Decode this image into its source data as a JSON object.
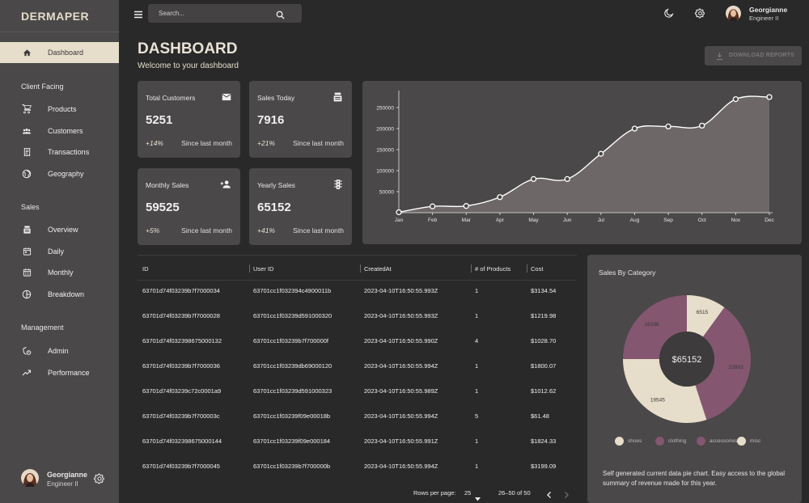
{
  "brand": "DERMAPER",
  "sidebar": {
    "items": [
      {
        "label": "Dashboard",
        "icon": "home-icon",
        "active": true
      },
      {
        "section": "Client Facing"
      },
      {
        "label": "Products",
        "icon": "cart-icon"
      },
      {
        "label": "Customers",
        "icon": "groups-icon"
      },
      {
        "label": "Transactions",
        "icon": "receipt-icon"
      },
      {
        "label": "Geography",
        "icon": "globe-icon"
      },
      {
        "section": "Sales"
      },
      {
        "label": "Overview",
        "icon": "point-of-sale-icon"
      },
      {
        "label": "Daily",
        "icon": "calendar-today-icon"
      },
      {
        "label": "Monthly",
        "icon": "calendar-month-icon"
      },
      {
        "label": "Breakdown",
        "icon": "pie-chart-icon"
      },
      {
        "section": "Management"
      },
      {
        "label": "Admin",
        "icon": "admin-shield-icon"
      },
      {
        "label": "Performance",
        "icon": "trending-up-icon"
      }
    ],
    "user": {
      "name": "Georgianne",
      "role": "Engineer II"
    }
  },
  "topbar": {
    "search_placeholder": "Search...",
    "user": {
      "name": "Georgianne",
      "role": "Engineer II"
    }
  },
  "header": {
    "title": "DASHBOARD",
    "subtitle": "Welcome to your dashboard",
    "download_label": "DOWNLOAD REPORTS"
  },
  "stats": [
    {
      "title": "Total Customers",
      "value": "5251",
      "pct": "+14%",
      "since": "Since last month",
      "icon": "email-icon"
    },
    {
      "title": "Sales Today",
      "value": "7916",
      "pct": "+21%",
      "since": "Since last month",
      "icon": "point-of-sale-icon"
    },
    {
      "title": "Monthly Sales",
      "value": "59525",
      "pct": "+5%",
      "since": "Since last month",
      "icon": "person-add-icon"
    },
    {
      "title": "Yearly Sales",
      "value": "65152",
      "pct": "+41%",
      "since": "Since last month",
      "icon": "traffic-icon"
    }
  ],
  "chart_data": [
    {
      "type": "area",
      "title": "",
      "categories": [
        "Jan",
        "Feb",
        "Mar",
        "Apr",
        "May",
        "Jun",
        "Jul",
        "Aug",
        "Sep",
        "Oct",
        "Nov",
        "Dec"
      ],
      "series": [
        {
          "values": [
            1000,
            15000,
            16000,
            37000,
            80000,
            80000,
            140000,
            200000,
            205000,
            207000,
            270000,
            275000
          ]
        }
      ],
      "yticks": [
        50000,
        100000,
        150000,
        200000,
        250000
      ],
      "ylim": [
        0,
        275000
      ],
      "grid": false,
      "colors": {
        "fill": "#6d6767",
        "line": "#ffffff"
      }
    },
    {
      "type": "pie",
      "title": "Sales By Category",
      "center_label": "$65152",
      "slices": [
        {
          "name": "shoes",
          "value": 6515,
          "color": "#e6ddca"
        },
        {
          "name": "clothing",
          "value": 22803,
          "color": "#845670"
        },
        {
          "name": "accessories",
          "value": 19545,
          "color": "#e6ddca"
        },
        {
          "name": "misc",
          "value": 16288,
          "color": "#845670"
        }
      ],
      "legend": [
        {
          "name": "shoes",
          "color": "#e6ddca"
        },
        {
          "name": "clothing",
          "color": "#845670"
        },
        {
          "name": "accessories",
          "color": "#845670"
        },
        {
          "name": "misc",
          "color": "#e6ddca"
        }
      ],
      "description": "Self generated current data pie chart. Easy access to the global summary of revenue made for this year."
    }
  ],
  "table": {
    "columns": [
      "ID",
      "User ID",
      "CreatedAt",
      "# of Products",
      "Cost"
    ],
    "rows": [
      [
        "63701d74f03239b7f7000034",
        "63701cc1f032394c4900011b",
        "2023-04-10T16:50:55.993Z",
        "1",
        "$3134.54"
      ],
      [
        "63701d74f03239b7f7000028",
        "63701cc1f03239d591000320",
        "2023-04-10T16:50:55.993Z",
        "1",
        "$1219.98"
      ],
      [
        "63701d74f032398675000132",
        "63701cc1f03239b7f700000f",
        "2023-04-10T16:50:55.990Z",
        "4",
        "$1028.70"
      ],
      [
        "63701d74f03239b7f7000036",
        "63701cc1f03239db69000120",
        "2023-04-10T16:50:55.994Z",
        "1",
        "$1800.07"
      ],
      [
        "63701d74f03239c72c0001a9",
        "63701cc1f03239d591000323",
        "2023-04-10T16:50:55.989Z",
        "1",
        "$1012.62"
      ],
      [
        "63701d74f03239b7f700003c",
        "63701cc1f03239f09e00018b",
        "2023-04-10T16:50:55.994Z",
        "5",
        "$61.48"
      ],
      [
        "63701d74f032398675000144",
        "63701cc1f03239f09e000184",
        "2023-04-10T16:50:55.991Z",
        "1",
        "$1824.33"
      ],
      [
        "63701d74f03239b7f7000045",
        "63701cc1f03239b7f700000b",
        "2023-04-10T16:50:55.994Z",
        "1",
        "$3199.09"
      ]
    ],
    "footer": {
      "rows_per_page_label": "Rows per page:",
      "rows_per_page": "25",
      "range": "26–50 of 50"
    }
  }
}
